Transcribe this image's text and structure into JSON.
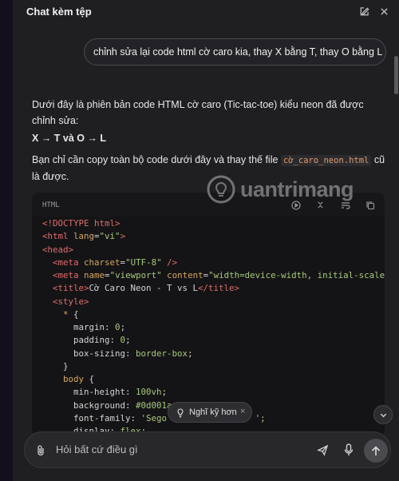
{
  "header": {
    "title": "Chat kèm tệp"
  },
  "user_message": "chỉnh sửa lại code html cờ caro kia, thay X bằng T, thay O bằng L",
  "answer": {
    "intro": "Dưới đây là phiên bản code HTML cờ caro (Tic-tac-toe) kiểu neon đã được chỉnh sửa:",
    "mapping": "X → T và O → L",
    "copy_prefix": "Bạn chỉ cần copy toàn bộ code dưới đây và thay thế file ",
    "filename": "cờ_caro_neon.html",
    "copy_suffix": " cũ là được."
  },
  "code_block": {
    "language": "HTML",
    "lines": {
      "l1_tag": "<!DOCTYPE html>",
      "l2_open": "<html ",
      "l2_attr": "lang",
      "l2_eq": "=",
      "l2_val": "\"vi\"",
      "l2_close": ">",
      "l3": "<head>",
      "l4_open": "<meta ",
      "l4_attr": "charset",
      "l4_eq": "=",
      "l4_val": "\"UTF-8\"",
      "l4_close": " />",
      "l5_open": "<meta ",
      "l5_attr1": "name",
      "l5_eq1": "=",
      "l5_val1": "\"viewport\"",
      "l5_sp": " ",
      "l5_attr2": "content",
      "l5_eq2": "=",
      "l5_val2": "\"width=device-width, initial-scale=",
      "l6_open": "<title>",
      "l6_text": "Cờ Caro Neon - T vs L",
      "l6_close": "</title>",
      "l7": "<style>",
      "l8_sel": "* ",
      "l8_brace": "{",
      "l9_prop": "margin",
      "l9_colon": ": ",
      "l9_val": "0",
      "l9_semi": ";",
      "l10_prop": "padding",
      "l10_colon": ": ",
      "l10_val": "0",
      "l10_semi": ";",
      "l11_prop": "box-sizing",
      "l11_colon": ": ",
      "l11_val": "border-box",
      "l11_semi": ";",
      "l12": "}",
      "l13_sel": "body ",
      "l13_brace": "{",
      "l14_prop": "min-height",
      "l14_colon": ": ",
      "l14_val": "100vh",
      "l14_semi": ";",
      "l15_prop": "background",
      "l15_colon": ": ",
      "l15_val": "#0d001a",
      "l16_prop": "font-family",
      "l16_colon": ": ",
      "l16_val": "'Sego",
      "l16_tail": "';",
      "l17_prop": "display",
      "l17_colon": ": ",
      "l17_val": "flex",
      "l17_semi": ";"
    }
  },
  "watermark": {
    "text": "uantrimang"
  },
  "think_chip": {
    "label": "Nghĩ kỹ hơn",
    "close": "×"
  },
  "input": {
    "placeholder": "Hỏi bất cứ điều gì"
  },
  "icons": {
    "edit": "edit-icon",
    "close": "close-icon",
    "run": "run-icon",
    "collapse": "collapse-icon",
    "wrap": "wrap-icon",
    "copy": "copy-icon",
    "bulb": "lightbulb-icon",
    "attach": "paperclip-icon",
    "voice": "voice-send-icon",
    "mic": "microphone-icon",
    "send": "arrow-up-icon",
    "chevron": "chevron-down-icon"
  },
  "colors": {
    "background": "#1f1f22",
    "code_bg": "#141416",
    "tag": "#e06c6c",
    "attr": "#d7a65f",
    "string": "#a9c97a",
    "inline_code": "#e59a6b"
  }
}
